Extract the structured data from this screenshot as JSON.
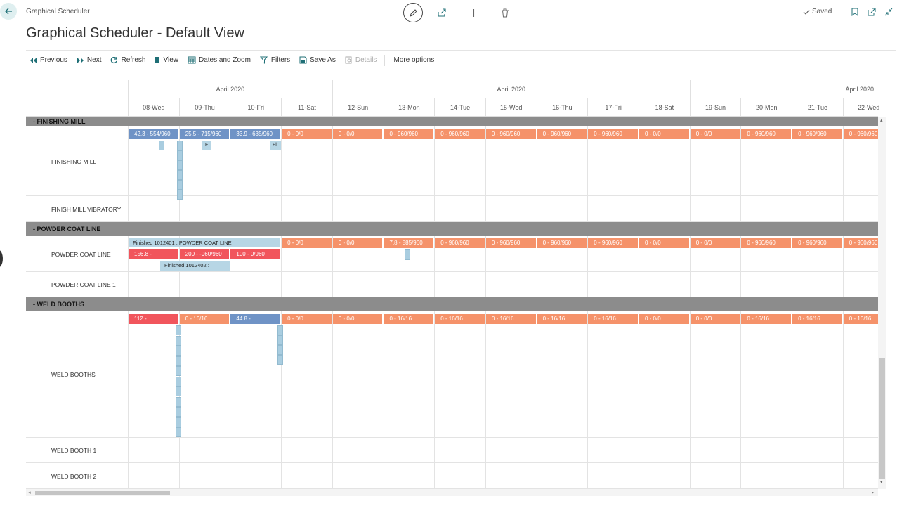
{
  "header": {
    "breadcrumb": "Graphical Scheduler",
    "title": "Graphical Scheduler - Default View",
    "saved_label": "Saved"
  },
  "actions": [
    {
      "label": "Previous",
      "icon": "previous-icon"
    },
    {
      "label": "Next",
      "icon": "next-icon"
    },
    {
      "label": "Refresh",
      "icon": "refresh-icon"
    },
    {
      "label": "View",
      "icon": "view-icon"
    },
    {
      "label": "Dates and Zoom",
      "icon": "calendar-icon"
    },
    {
      "label": "Filters",
      "icon": "filter-icon"
    },
    {
      "label": "Save As",
      "icon": "save-icon"
    },
    {
      "label": "Details",
      "icon": "details-icon",
      "disabled": true
    },
    {
      "label": "More options",
      "icon": ""
    }
  ],
  "timeline": {
    "months": [
      "April 2020",
      "April 2020",
      "April 2020"
    ],
    "days": [
      "08-Wed",
      "09-Thu",
      "10-Fri",
      "11-Sat",
      "12-Sun",
      "13-Mon",
      "14-Tue",
      "15-Wed",
      "16-Thu",
      "17-Fri",
      "18-Sat",
      "19-Sun",
      "20-Mon",
      "21-Tue",
      "22-Wed"
    ]
  },
  "groups": [
    {
      "name": "- FINISHING MILL",
      "resources": [
        {
          "name": "FINISHING MILL",
          "capacity": [
            {
              "text": "42.3 - 554/960",
              "color": "blue"
            },
            {
              "text": "25.5 - 715/960",
              "color": "blue"
            },
            {
              "text": "33.9 - 635/960",
              "color": "blue"
            },
            {
              "text": "0 - 0/0",
              "color": "orange"
            },
            {
              "text": "0 - 0/0",
              "color": "orange"
            },
            {
              "text": "0 - 960/960",
              "color": "orange"
            },
            {
              "text": "0 - 960/960",
              "color": "orange"
            },
            {
              "text": "0 - 960/960",
              "color": "orange"
            },
            {
              "text": "0 - 960/960",
              "color": "orange"
            },
            {
              "text": "0 - 960/960",
              "color": "orange"
            },
            {
              "text": "0 - 0/0",
              "color": "orange"
            },
            {
              "text": "0 - 0/0",
              "color": "orange"
            },
            {
              "text": "0 - 960/960",
              "color": "orange"
            },
            {
              "text": "0 - 960/960",
              "color": "orange"
            },
            {
              "text": "0 - 960/960",
              "color": "orange"
            }
          ],
          "job_labels": [
            "F",
            "Fi"
          ]
        },
        {
          "name": "FINISH MILL VIBRATORY"
        }
      ]
    },
    {
      "name": "- POWDER COAT LINE",
      "resources": [
        {
          "name": "POWDER COAT LINE",
          "top_job": "Finished 1012401 : POWDER COAT LINE",
          "second_job": "Finished 1012402 :",
          "capacity": [
            {
              "text": "156.8 -",
              "color": "red"
            },
            {
              "text": "200 - -960/960",
              "color": "red"
            },
            {
              "text": "100 - 0/960",
              "color": "red"
            },
            {
              "text": "0 - 0/0",
              "color": "orange"
            },
            {
              "text": "0 - 0/0",
              "color": "orange"
            },
            {
              "text": "7.8 - 885/960",
              "color": "orange"
            },
            {
              "text": "0 - 960/960",
              "color": "orange"
            },
            {
              "text": "0 - 960/960",
              "color": "orange"
            },
            {
              "text": "0 - 960/960",
              "color": "orange"
            },
            {
              "text": "0 - 960/960",
              "color": "orange"
            },
            {
              "text": "0 - 0/0",
              "color": "orange"
            },
            {
              "text": "0 - 0/0",
              "color": "orange"
            },
            {
              "text": "0 - 960/960",
              "color": "orange"
            },
            {
              "text": "0 - 960/960",
              "color": "orange"
            },
            {
              "text": "0 - 960/960",
              "color": "orange"
            }
          ]
        },
        {
          "name": "POWDER COAT LINE 1"
        }
      ]
    },
    {
      "name": "- WELD BOOTHS",
      "resources": [
        {
          "name": "WELD BOOTHS",
          "capacity": [
            {
              "text": "112 -",
              "color": "red"
            },
            {
              "text": "0 - 16/16",
              "color": "orange"
            },
            {
              "text": "44.8 -",
              "color": "blue"
            },
            {
              "text": "0 - 0/0",
              "color": "orange"
            },
            {
              "text": "0 - 0/0",
              "color": "orange"
            },
            {
              "text": "0 - 16/16",
              "color": "orange"
            },
            {
              "text": "0 - 16/16",
              "color": "orange"
            },
            {
              "text": "0 - 16/16",
              "color": "orange"
            },
            {
              "text": "0 - 16/16",
              "color": "orange"
            },
            {
              "text": "0 - 16/16",
              "color": "orange"
            },
            {
              "text": "0 - 0/0",
              "color": "orange"
            },
            {
              "text": "0 - 0/0",
              "color": "orange"
            },
            {
              "text": "0 - 16/16",
              "color": "orange"
            },
            {
              "text": "0 - 16/16",
              "color": "orange"
            },
            {
              "text": "0 - 16/16",
              "color": "orange"
            }
          ]
        },
        {
          "name": "WELD BOOTH 1"
        },
        {
          "name": "WELD BOOTH 2"
        }
      ]
    }
  ],
  "colors": {
    "accent": "#1f6f76",
    "blue": "#6f93c6",
    "orange": "#f5926a",
    "red": "#f1555c",
    "job": "#a9cde0",
    "group_bar": "#8c8c8c"
  }
}
